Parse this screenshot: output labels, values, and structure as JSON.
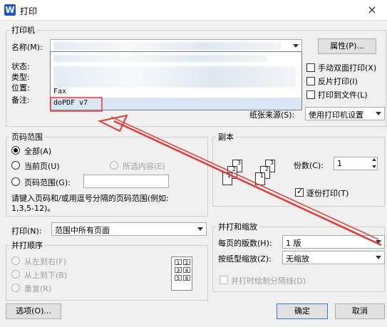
{
  "window": {
    "title": "打印",
    "app_icon": "W"
  },
  "printer": {
    "group": "打印机",
    "name_label": "名称(M):",
    "status_label": "状态:",
    "type_label": "类型:",
    "location_label": "位置:",
    "comment_label": "备注:",
    "properties_button": "属性(P)...",
    "duplex": "手动双面打印(X)",
    "reverse": "反片打印(I)",
    "print_to_file": "打印到文件(L)",
    "paper_source_label": "纸张来源(S):",
    "paper_source_value": "使用打印机设置",
    "list": [
      "Fax",
      "doPDF v7"
    ]
  },
  "page_range": {
    "group": "页码范围",
    "all": "全部(A)",
    "current": "当前页(U)",
    "selection": "所选内容(E)",
    "range": "页码范围(G):",
    "hint": "请键入页码和/或用逗号分隔的页码范围(例如:",
    "hint2": "1,3,5-12)。"
  },
  "copies": {
    "group": "副本",
    "count_label": "份数(C):",
    "count_value": "1",
    "collate": "逐份打印(T)"
  },
  "print_what": {
    "label": "打印(N):",
    "value": "范围中所有页面"
  },
  "order": {
    "group": "并打顺序",
    "lr": "从左到右(F)",
    "tb": "从上到下(B)",
    "repeat": "重复(R)"
  },
  "zoom": {
    "group": "并打和缩放",
    "pages_label": "每页的版数(H):",
    "pages_value": "1 版",
    "scale_label": "按纸型缩放(Z):",
    "scale_value": "无缩放",
    "draw_borders": "并打时绘制分隔线(D)"
  },
  "buttons": {
    "options": "选项(O)...",
    "ok": "确定",
    "cancel": "取消"
  },
  "icons": {
    "close": "×"
  },
  "annotation": {
    "color": "#e53935"
  }
}
